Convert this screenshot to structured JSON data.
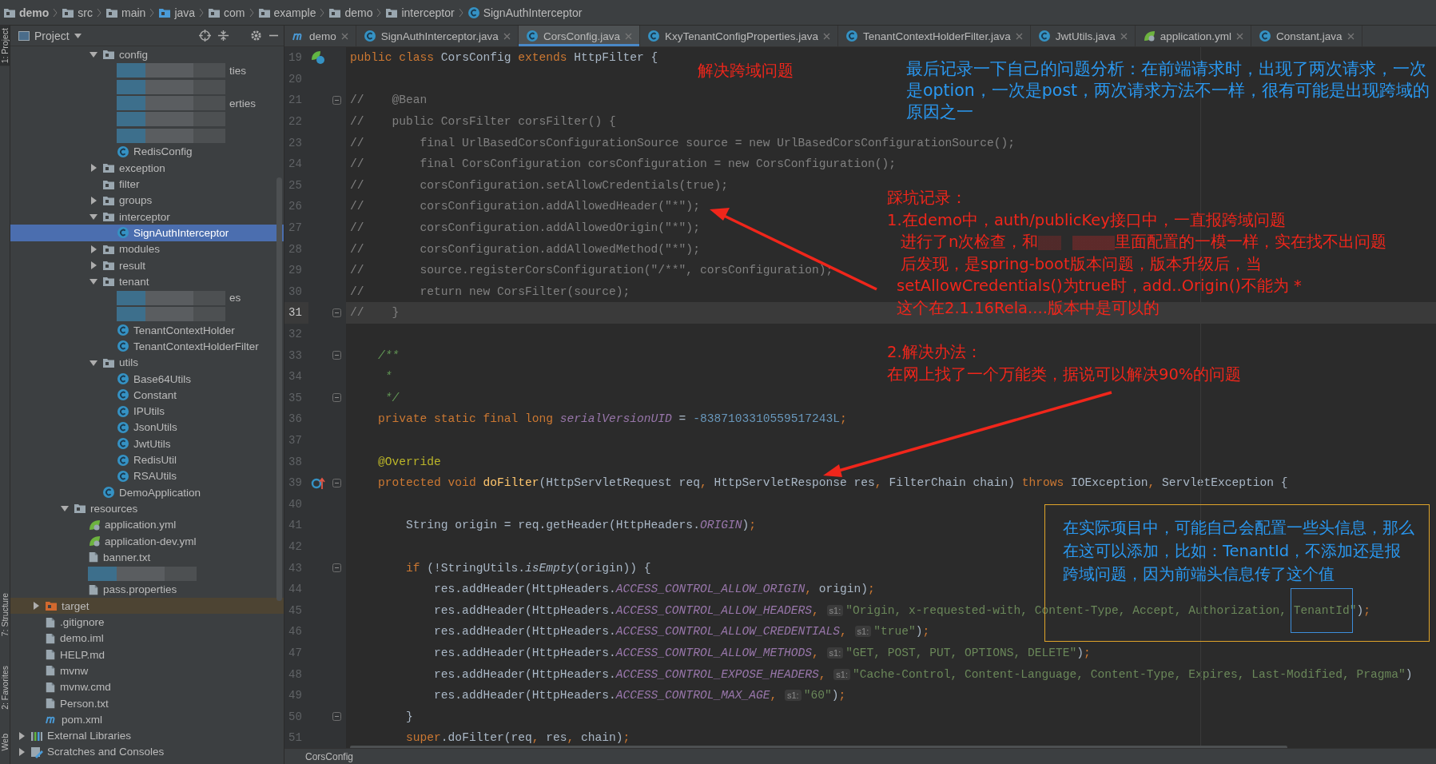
{
  "breadcrumb": [
    {
      "label": "demo",
      "kind": "module"
    },
    {
      "label": "src",
      "kind": "folder"
    },
    {
      "label": "main",
      "kind": "folder"
    },
    {
      "label": "java",
      "kind": "source-folder"
    },
    {
      "label": "com",
      "kind": "folder"
    },
    {
      "label": "example",
      "kind": "folder"
    },
    {
      "label": "demo",
      "kind": "folder"
    },
    {
      "label": "interceptor",
      "kind": "folder"
    },
    {
      "label": "SignAuthInterceptor",
      "kind": "class"
    }
  ],
  "tool_strip": [
    "1: Project",
    "7: Structure",
    "2: Favorites",
    "Web"
  ],
  "project_panel": {
    "title": "Project",
    "tree": [
      {
        "children": [
          {
            "children": [
              {
                "children": [
                  {
                    "children": [
                      {
                        "children": [
                          {
                            "label": "config",
                            "kind": "folder",
                            "selected": false,
                            "expanded": true,
                            "children": [
                              {
                                "kind": "redacted",
                                "label": "ties",
                                "selected": false
                              },
                              {
                                "kind": "redacted",
                                "selected": false
                              },
                              {
                                "kind": "redacted",
                                "label": "erties",
                                "selected": false
                              },
                              {
                                "kind": "redacted",
                                "selected": false
                              },
                              {
                                "kind": "redacted",
                                "selected": false
                              },
                              {
                                "label": "RedisConfig",
                                "kind": "class",
                                "selected": false
                              }
                            ]
                          },
                          {
                            "label": "exception",
                            "kind": "folder",
                            "selected": false,
                            "expanded": false
                          },
                          {
                            "label": "filter",
                            "kind": "folder",
                            "selected": false
                          },
                          {
                            "label": "groups",
                            "kind": "folder",
                            "selected": false,
                            "expanded": false
                          },
                          {
                            "label": "interceptor",
                            "kind": "folder",
                            "selected": false,
                            "expanded": true,
                            "children": [
                              {
                                "label": "SignAuthInterceptor",
                                "kind": "class",
                                "selected": true
                              }
                            ]
                          },
                          {
                            "label": "modules",
                            "kind": "folder",
                            "selected": false,
                            "expanded": false
                          },
                          {
                            "label": "result",
                            "kind": "folder",
                            "selected": false,
                            "expanded": false
                          },
                          {
                            "label": "tenant",
                            "kind": "folder",
                            "selected": false,
                            "expanded": true,
                            "children": [
                              {
                                "kind": "redacted",
                                "label": "es",
                                "selected": false
                              },
                              {
                                "kind": "redacted",
                                "selected": false
                              },
                              {
                                "label": "TenantContextHolder",
                                "kind": "class",
                                "selected": false
                              },
                              {
                                "label": "TenantContextHolderFilter",
                                "kind": "class",
                                "selected": false
                              }
                            ]
                          },
                          {
                            "label": "utils",
                            "kind": "folder",
                            "selected": false,
                            "expanded": true,
                            "children": [
                              {
                                "label": "Base64Utils",
                                "kind": "class",
                                "selected": false
                              },
                              {
                                "label": "Constant",
                                "kind": "class",
                                "selected": false
                              },
                              {
                                "label": "IPUtils",
                                "kind": "class",
                                "selected": false
                              },
                              {
                                "label": "JsonUtils",
                                "kind": "class",
                                "selected": false
                              },
                              {
                                "label": "JwtUtils",
                                "kind": "class",
                                "selected": false
                              },
                              {
                                "label": "RedisUtil",
                                "kind": "class",
                                "selected": false
                              },
                              {
                                "label": "RSAUtils",
                                "kind": "class",
                                "selected": false
                              }
                            ]
                          },
                          {
                            "label": "DemoApplication",
                            "kind": "app-class",
                            "selected": false
                          }
                        ]
                      }
                    ]
                  },
                  {
                    "label": "resources",
                    "kind": "resources-folder",
                    "selected": false,
                    "expanded": true,
                    "children": [
                      {
                        "label": "application.yml",
                        "kind": "yml",
                        "selected": false
                      },
                      {
                        "label": "application-dev.yml",
                        "kind": "yml",
                        "selected": false
                      },
                      {
                        "label": "banner.txt",
                        "kind": "file",
                        "selected": false
                      },
                      {
                        "kind": "redacted",
                        "selected": false
                      },
                      {
                        "label": "pass.properties",
                        "kind": "properties",
                        "selected": false
                      }
                    ]
                  }
                ]
              }
            ]
          },
          {
            "label": "target",
            "kind": "excluded-folder",
            "selected": false,
            "expanded": false
          },
          {
            "label": ".gitignore",
            "kind": "file",
            "selected": false
          },
          {
            "label": "demo.iml",
            "kind": "file",
            "selected": false
          },
          {
            "label": "HELP.md",
            "kind": "md",
            "selected": false
          },
          {
            "label": "mvnw",
            "kind": "file",
            "selected": false
          },
          {
            "label": "mvnw.cmd",
            "kind": "file",
            "selected": false
          },
          {
            "label": "Person.txt",
            "kind": "file",
            "selected": false
          },
          {
            "label": "pom.xml",
            "kind": "maven",
            "selected": false
          }
        ]
      },
      {
        "label": "External Libraries",
        "kind": "libraries",
        "selected": false,
        "expanded": false
      },
      {
        "label": "Scratches and Consoles",
        "kind": "scratches",
        "selected": false,
        "expanded": false
      }
    ]
  },
  "tabs": [
    {
      "label": "demo",
      "kind": "maven",
      "selected": false
    },
    {
      "label": "SignAuthInterceptor.java",
      "kind": "class",
      "selected": false
    },
    {
      "label": "CorsConfig.java",
      "kind": "class",
      "selected": true
    },
    {
      "label": "KxyTenantConfigProperties.java",
      "kind": "class",
      "selected": false
    },
    {
      "label": "TenantContextHolderFilter.java",
      "kind": "class",
      "selected": false
    },
    {
      "label": "JwtUtils.java",
      "kind": "class",
      "selected": false
    },
    {
      "label": "application.yml",
      "kind": "yml",
      "selected": false
    },
    {
      "label": "Constant.java",
      "kind": "class",
      "selected": false
    }
  ],
  "editor": {
    "lines": [
      {
        "n": "19",
        "kind": "class-declaration",
        "current": false,
        "fold": false,
        "tokens": [
          {
            "kind": "keyword",
            "text": "public class "
          },
          {
            "kind": "plain",
            "text": "CorsConfig "
          },
          {
            "kind": "keyword",
            "text": "extends "
          },
          {
            "kind": "plain",
            "text": "HttpFilter {"
          }
        ]
      },
      {
        "n": "20",
        "kind": "code",
        "current": false,
        "fold": false
      },
      {
        "n": "21",
        "kind": "code",
        "current": false,
        "fold": true,
        "tokens": [
          {
            "kind": "comment",
            "text": "//    @Bean"
          }
        ]
      },
      {
        "n": "22",
        "kind": "code",
        "current": false,
        "fold": false,
        "tokens": [
          {
            "kind": "comment",
            "text": "//    public CorsFilter corsFilter() {"
          }
        ]
      },
      {
        "n": "23",
        "kind": "code",
        "current": false,
        "fold": false,
        "tokens": [
          {
            "kind": "comment",
            "text": "//        final UrlBasedCorsConfigurationSource source = new UrlBasedCorsConfigurationSource();"
          }
        ]
      },
      {
        "n": "24",
        "kind": "code",
        "current": false,
        "fold": false,
        "tokens": [
          {
            "kind": "comment",
            "text": "//        final CorsConfiguration corsConfiguration = new CorsConfiguration();"
          }
        ]
      },
      {
        "n": "25",
        "kind": "code",
        "current": false,
        "fold": false,
        "tokens": [
          {
            "kind": "comment",
            "text": "//        corsConfiguration.setAllowCredentials(true);"
          }
        ]
      },
      {
        "n": "26",
        "kind": "code",
        "current": false,
        "fold": false,
        "tokens": [
          {
            "kind": "comment",
            "text": "//        corsConfiguration.addAllowedHeader(\"*\");"
          }
        ]
      },
      {
        "n": "27",
        "kind": "code",
        "current": false,
        "fold": false,
        "tokens": [
          {
            "kind": "comment",
            "text": "//        corsConfiguration.addAllowedOrigin(\"*\");"
          }
        ]
      },
      {
        "n": "28",
        "kind": "code",
        "current": false,
        "fold": false,
        "tokens": [
          {
            "kind": "comment",
            "text": "//        corsConfiguration.addAllowedMethod(\"*\");"
          }
        ]
      },
      {
        "n": "29",
        "kind": "code",
        "current": false,
        "fold": false,
        "tokens": [
          {
            "kind": "comment",
            "text": "//        source.registerCorsConfiguration(\"/**\", corsConfiguration);"
          }
        ]
      },
      {
        "n": "30",
        "kind": "code",
        "current": false,
        "fold": false,
        "tokens": [
          {
            "kind": "comment",
            "text": "//        return new CorsFilter(source);"
          }
        ]
      },
      {
        "n": "31",
        "kind": "code",
        "current": true,
        "fold": true,
        "tokens": [
          {
            "kind": "comment",
            "text": "//    }"
          }
        ]
      },
      {
        "n": "32",
        "kind": "code",
        "current": false,
        "fold": false
      },
      {
        "n": "33",
        "kind": "code",
        "current": false,
        "fold": true,
        "tokens": [
          {
            "kind": "doc",
            "text": "    /**"
          }
        ]
      },
      {
        "n": "34",
        "kind": "code",
        "current": false,
        "fold": false,
        "tokens": [
          {
            "kind": "doc",
            "text": "     *"
          }
        ]
      },
      {
        "n": "35",
        "kind": "code",
        "current": false,
        "fold": true,
        "tokens": [
          {
            "kind": "doc",
            "text": "     */"
          }
        ]
      },
      {
        "n": "36",
        "kind": "code",
        "current": false,
        "fold": false,
        "tokens": [
          {
            "kind": "keyword",
            "text": "    private static final long "
          },
          {
            "kind": "constant",
            "text": "serialVersionUID"
          },
          {
            "kind": "plain",
            "text": " = "
          },
          {
            "kind": "number",
            "text": "-8387103310559517243L"
          },
          {
            "kind": "keyword",
            "text": ";"
          }
        ]
      },
      {
        "n": "37",
        "kind": "code",
        "current": false,
        "fold": false
      },
      {
        "n": "38",
        "kind": "code",
        "current": false,
        "fold": false,
        "tokens": [
          {
            "kind": "annotation",
            "text": "    @Override"
          }
        ]
      },
      {
        "n": "39",
        "kind": "override-method",
        "current": false,
        "fold": true,
        "tokens": [
          {
            "kind": "keyword",
            "text": "    protected void "
          },
          {
            "kind": "method",
            "text": "doFilter"
          },
          {
            "kind": "plain",
            "text": "(HttpServletRequest req"
          },
          {
            "kind": "keyword",
            "text": ", "
          },
          {
            "kind": "plain",
            "text": "HttpServletResponse res"
          },
          {
            "kind": "keyword",
            "text": ", "
          },
          {
            "kind": "plain",
            "text": "FilterChain chain) "
          },
          {
            "kind": "keyword",
            "text": "throws "
          },
          {
            "kind": "plain",
            "text": "IOException"
          },
          {
            "kind": "keyword",
            "text": ", "
          },
          {
            "kind": "plain",
            "text": "ServletException {"
          }
        ]
      },
      {
        "n": "40",
        "kind": "code",
        "current": false,
        "fold": false
      },
      {
        "n": "41",
        "kind": "code",
        "current": false,
        "fold": false,
        "tokens": [
          {
            "kind": "plain",
            "text": "        String origin = req.getHeader(HttpHeaders."
          },
          {
            "kind": "constant",
            "text": "ORIGIN"
          },
          {
            "kind": "plain",
            "text": ")"
          },
          {
            "kind": "keyword",
            "text": ";"
          }
        ]
      },
      {
        "n": "42",
        "kind": "code",
        "current": false,
        "fold": false
      },
      {
        "n": "43",
        "kind": "code",
        "current": false,
        "fold": true,
        "tokens": [
          {
            "kind": "keyword",
            "text": "        if "
          },
          {
            "kind": "plain",
            "text": "(!StringUtils."
          },
          {
            "kind": "italic",
            "text": "isEmpty"
          },
          {
            "kind": "plain",
            "text": "(origin)) {"
          }
        ]
      },
      {
        "n": "44",
        "kind": "code",
        "current": false,
        "fold": false,
        "tokens": [
          {
            "kind": "plain",
            "text": "            res.addHeader(HttpHeaders."
          },
          {
            "kind": "constant",
            "text": "ACCESS_CONTROL_ALLOW_ORIGIN"
          },
          {
            "kind": "keyword",
            "text": ", "
          },
          {
            "kind": "plain",
            "text": "origin)"
          },
          {
            "kind": "keyword",
            "text": ";"
          }
        ]
      },
      {
        "n": "45",
        "kind": "code",
        "current": false,
        "fold": false,
        "tokens": [
          {
            "kind": "plain",
            "text": "            res.addHeader(HttpHeaders."
          },
          {
            "kind": "constant",
            "text": "ACCESS_CONTROL_ALLOW_HEADERS"
          },
          {
            "kind": "keyword",
            "text": ", "
          },
          {
            "kind": "hint",
            "text": "s1:"
          },
          {
            "kind": "string",
            "text": "\"Origin, x-requested-with, Content-Type, Accept, Authorization, "
          },
          {
            "kind": "boxed-string",
            "text": "TenantId"
          },
          {
            "kind": "string",
            "text": "\""
          },
          {
            "kind": "plain",
            "text": ")"
          },
          {
            "kind": "keyword",
            "text": ";"
          }
        ]
      },
      {
        "n": "46",
        "kind": "code",
        "current": false,
        "fold": false,
        "tokens": [
          {
            "kind": "plain",
            "text": "            res.addHeader(HttpHeaders."
          },
          {
            "kind": "constant",
            "text": "ACCESS_CONTROL_ALLOW_CREDENTIALS"
          },
          {
            "kind": "keyword",
            "text": ", "
          },
          {
            "kind": "hint",
            "text": "s1:"
          },
          {
            "kind": "string",
            "text": "\"true\""
          },
          {
            "kind": "plain",
            "text": ")"
          },
          {
            "kind": "keyword",
            "text": ";"
          }
        ]
      },
      {
        "n": "47",
        "kind": "code",
        "current": false,
        "fold": false,
        "tokens": [
          {
            "kind": "plain",
            "text": "            res.addHeader(HttpHeaders."
          },
          {
            "kind": "constant",
            "text": "ACCESS_CONTROL_ALLOW_METHODS"
          },
          {
            "kind": "keyword",
            "text": ", "
          },
          {
            "kind": "hint",
            "text": "s1:"
          },
          {
            "kind": "string",
            "text": "\"GET, POST, PUT, OPTIONS, DELETE\""
          },
          {
            "kind": "plain",
            "text": ")"
          },
          {
            "kind": "keyword",
            "text": ";"
          }
        ]
      },
      {
        "n": "48",
        "kind": "code",
        "current": false,
        "fold": false,
        "tokens": [
          {
            "kind": "plain",
            "text": "            res.addHeader(HttpHeaders."
          },
          {
            "kind": "constant",
            "text": "ACCESS_CONTROL_EXPOSE_HEADERS"
          },
          {
            "kind": "keyword",
            "text": ", "
          },
          {
            "kind": "hint",
            "text": "s1:"
          },
          {
            "kind": "string",
            "text": "\"Cache-Control, Content-Language, Content-Type, Expires, Last-Modified, Pragma\""
          },
          {
            "kind": "plain",
            "text": ")"
          }
        ]
      },
      {
        "n": "49",
        "kind": "code",
        "current": false,
        "fold": false,
        "tokens": [
          {
            "kind": "plain",
            "text": "            res.addHeader(HttpHeaders."
          },
          {
            "kind": "constant",
            "text": "ACCESS_CONTROL_MAX_AGE"
          },
          {
            "kind": "keyword",
            "text": ", "
          },
          {
            "kind": "hint",
            "text": "s1:"
          },
          {
            "kind": "string",
            "text": "\"60\""
          },
          {
            "kind": "plain",
            "text": ")"
          },
          {
            "kind": "keyword",
            "text": ";"
          }
        ]
      },
      {
        "n": "50",
        "kind": "code",
        "current": false,
        "fold": true,
        "tokens": [
          {
            "kind": "plain",
            "text": "        }"
          }
        ]
      },
      {
        "n": "51",
        "kind": "code",
        "current": false,
        "fold": false,
        "tokens": [
          {
            "kind": "keyword",
            "text": "        super"
          },
          {
            "kind": "plain",
            "text": ".doFilter(req"
          },
          {
            "kind": "keyword",
            "text": ", "
          },
          {
            "kind": "plain",
            "text": "res"
          },
          {
            "kind": "keyword",
            "text": ", "
          },
          {
            "kind": "plain",
            "text": "chain)"
          },
          {
            "kind": "keyword",
            "text": ";"
          }
        ]
      }
    ],
    "status": "CorsConfig"
  },
  "annotations": {
    "heading": "解决跨域问题",
    "analysis": [
      "最后记录一下自己的问题分析：在前端请求时，出现了两次请求，一次",
      "是option，一次是post，两次请求方法不一样，很有可能是出现跨域的",
      "原因之一"
    ],
    "pitfalls": [
      "踩坑记录：",
      "1.在demo中，auth/publicKey接口中，一直报跨域问题",
      [
        "进行了n次检查，和",
        "里面配置的一模一样，实在找不出问题"
      ],
      "后发现，是spring-boot版本问题，版本升级后，当",
      "setAllowCredentials()为true时，add..Origin()不能为  *",
      "这个在2.1.16Rela....版本中是可以的"
    ],
    "solution": [
      "2.解决办法：",
      "在网上找了一个万能类，据说可以解决90%的问题"
    ],
    "callout": [
      "在实际项目中，可能自己会配置一些头信息，那么",
      "在这可以添加，比如：TenantId，不添加还是报",
      "跨域问题，因为前端头信息传了这个值"
    ]
  }
}
